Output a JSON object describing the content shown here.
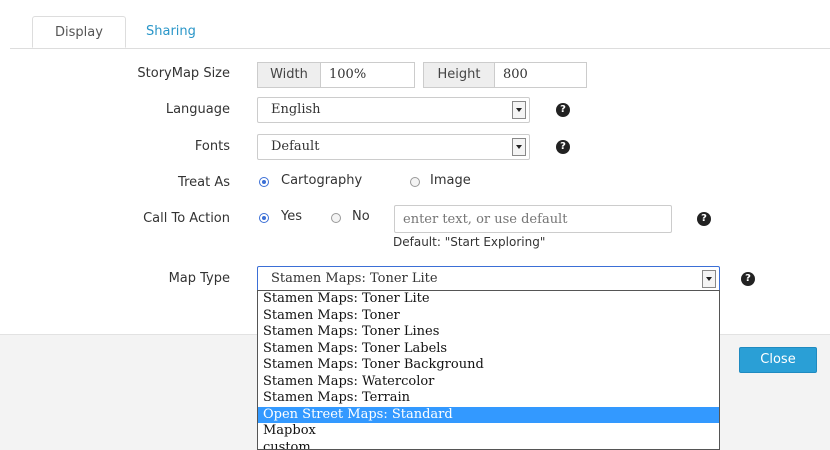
{
  "tabs": [
    {
      "label": "Display",
      "active": true
    },
    {
      "label": "Sharing",
      "active": false
    }
  ],
  "storymap_size": {
    "label": "StoryMap Size",
    "width_label": "Width",
    "width_value": "100%",
    "height_label": "Height",
    "height_value": "800"
  },
  "language": {
    "label": "Language",
    "value": "English"
  },
  "fonts": {
    "label": "Fonts",
    "value": "Default"
  },
  "treat_as": {
    "label": "Treat As",
    "options": [
      {
        "label": "Cartography",
        "selected": true
      },
      {
        "label": "Image",
        "selected": false
      }
    ]
  },
  "call_to_action": {
    "label": "Call To Action",
    "options": [
      {
        "label": "Yes",
        "selected": true
      },
      {
        "label": "No",
        "selected": false
      }
    ],
    "placeholder": "enter text, or use default",
    "default_note": "Default: \"Start Exploring\""
  },
  "map_type": {
    "label": "Map Type",
    "value": "Stamen Maps: Toner Lite",
    "options": [
      "Stamen Maps: Toner Lite",
      "Stamen Maps: Toner",
      "Stamen Maps: Toner Lines",
      "Stamen Maps: Toner Labels",
      "Stamen Maps: Toner Background",
      "Stamen Maps: Watercolor",
      "Stamen Maps: Terrain",
      "Open Street Maps: Standard",
      "Mapbox",
      "custom"
    ],
    "highlighted": "Open Street Maps: Standard"
  },
  "help_glyph": "?",
  "close_label": "Close",
  "colors": {
    "accent": "#2a9fd6",
    "tab_link": "#2a96c8",
    "highlight": "#3399ff"
  }
}
